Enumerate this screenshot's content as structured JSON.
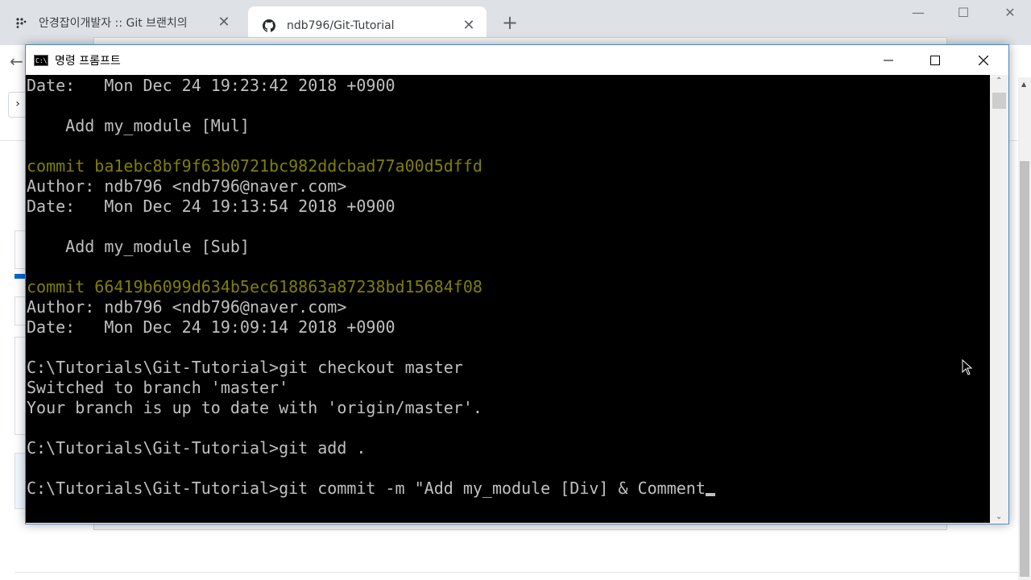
{
  "browser": {
    "tabs": [
      {
        "title": "안경잡이개발자 :: Git 브랜치의 ",
        "active": false
      },
      {
        "title": "ndb796/Git-Tutorial",
        "active": true
      }
    ],
    "new_tab_label": "+",
    "window_controls": {
      "minimize": "—",
      "maximize": "☐",
      "close": "✕"
    }
  },
  "cmd": {
    "title": "명령 프롬프트",
    "icon_label": "C:\\.",
    "controls": {
      "minimize": "—",
      "maximize": "☐",
      "close": "✕"
    },
    "lines": [
      {
        "text": "Date:   Mon Dec 24 19:23:42 2018 +0900",
        "kind": "normal"
      },
      {
        "text": "",
        "kind": "normal"
      },
      {
        "text": "    Add my_module [Mul]",
        "kind": "normal"
      },
      {
        "text": "",
        "kind": "normal"
      },
      {
        "text": "commit ba1ebc8bf9f63b0721bc982ddcbad77a00d5dffd",
        "kind": "hash"
      },
      {
        "text": "Author: ndb796 <ndb796@naver.com>",
        "kind": "normal"
      },
      {
        "text": "Date:   Mon Dec 24 19:13:54 2018 +0900",
        "kind": "normal"
      },
      {
        "text": "",
        "kind": "normal"
      },
      {
        "text": "    Add my_module [Sub]",
        "kind": "normal"
      },
      {
        "text": "",
        "kind": "normal"
      },
      {
        "text": "commit 66419b6099d634b5ec618863a87238bd15684f08",
        "kind": "hash"
      },
      {
        "text": "Author: ndb796 <ndb796@naver.com>",
        "kind": "normal"
      },
      {
        "text": "Date:   Mon Dec 24 19:09:14 2018 +0900",
        "kind": "normal"
      },
      {
        "text": "",
        "kind": "normal"
      },
      {
        "text": "C:\\Tutorials\\Git-Tutorial>git checkout master",
        "kind": "normal"
      },
      {
        "text": "Switched to branch 'master'",
        "kind": "normal"
      },
      {
        "text": "Your branch is up to date with 'origin/master'.",
        "kind": "normal"
      },
      {
        "text": "",
        "kind": "normal"
      },
      {
        "text": "C:\\Tutorials\\Git-Tutorial>git add .",
        "kind": "normal"
      },
      {
        "text": "",
        "kind": "normal"
      },
      {
        "text": "C:\\Tutorials\\Git-Tutorial>git commit -m \"Add my_module [Div] & Comment",
        "kind": "input"
      }
    ]
  },
  "colors": {
    "terminal_bg": "#000000",
    "terminal_fg": "#c0c0c0",
    "hash_fg": "#808000",
    "tab_bg": "#dee1e6"
  }
}
